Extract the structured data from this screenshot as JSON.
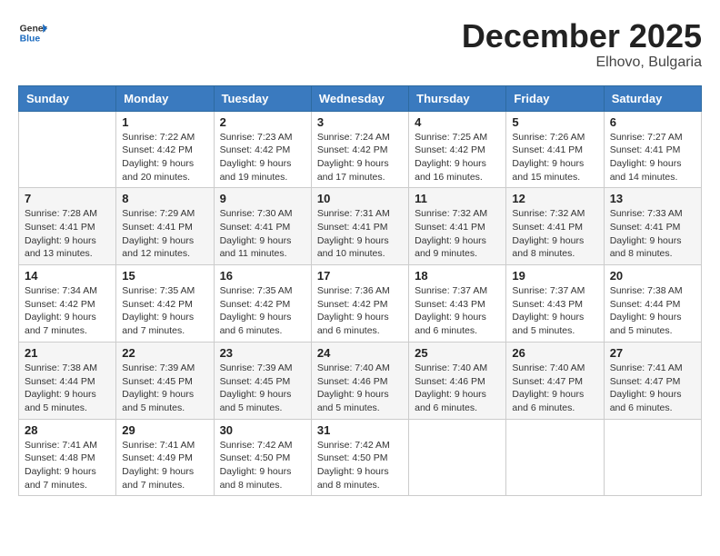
{
  "logo": {
    "general": "General",
    "blue": "Blue"
  },
  "title": "December 2025",
  "location": "Elhovo, Bulgaria",
  "weekdays": [
    "Sunday",
    "Monday",
    "Tuesday",
    "Wednesday",
    "Thursday",
    "Friday",
    "Saturday"
  ],
  "weeks": [
    [
      {
        "day": "",
        "info": ""
      },
      {
        "day": "1",
        "info": "Sunrise: 7:22 AM\nSunset: 4:42 PM\nDaylight: 9 hours\nand 20 minutes."
      },
      {
        "day": "2",
        "info": "Sunrise: 7:23 AM\nSunset: 4:42 PM\nDaylight: 9 hours\nand 19 minutes."
      },
      {
        "day": "3",
        "info": "Sunrise: 7:24 AM\nSunset: 4:42 PM\nDaylight: 9 hours\nand 17 minutes."
      },
      {
        "day": "4",
        "info": "Sunrise: 7:25 AM\nSunset: 4:42 PM\nDaylight: 9 hours\nand 16 minutes."
      },
      {
        "day": "5",
        "info": "Sunrise: 7:26 AM\nSunset: 4:41 PM\nDaylight: 9 hours\nand 15 minutes."
      },
      {
        "day": "6",
        "info": "Sunrise: 7:27 AM\nSunset: 4:41 PM\nDaylight: 9 hours\nand 14 minutes."
      }
    ],
    [
      {
        "day": "7",
        "info": "Sunrise: 7:28 AM\nSunset: 4:41 PM\nDaylight: 9 hours\nand 13 minutes."
      },
      {
        "day": "8",
        "info": "Sunrise: 7:29 AM\nSunset: 4:41 PM\nDaylight: 9 hours\nand 12 minutes."
      },
      {
        "day": "9",
        "info": "Sunrise: 7:30 AM\nSunset: 4:41 PM\nDaylight: 9 hours\nand 11 minutes."
      },
      {
        "day": "10",
        "info": "Sunrise: 7:31 AM\nSunset: 4:41 PM\nDaylight: 9 hours\nand 10 minutes."
      },
      {
        "day": "11",
        "info": "Sunrise: 7:32 AM\nSunset: 4:41 PM\nDaylight: 9 hours\nand 9 minutes."
      },
      {
        "day": "12",
        "info": "Sunrise: 7:32 AM\nSunset: 4:41 PM\nDaylight: 9 hours\nand 8 minutes."
      },
      {
        "day": "13",
        "info": "Sunrise: 7:33 AM\nSunset: 4:41 PM\nDaylight: 9 hours\nand 8 minutes."
      }
    ],
    [
      {
        "day": "14",
        "info": "Sunrise: 7:34 AM\nSunset: 4:42 PM\nDaylight: 9 hours\nand 7 minutes."
      },
      {
        "day": "15",
        "info": "Sunrise: 7:35 AM\nSunset: 4:42 PM\nDaylight: 9 hours\nand 7 minutes."
      },
      {
        "day": "16",
        "info": "Sunrise: 7:35 AM\nSunset: 4:42 PM\nDaylight: 9 hours\nand 6 minutes."
      },
      {
        "day": "17",
        "info": "Sunrise: 7:36 AM\nSunset: 4:42 PM\nDaylight: 9 hours\nand 6 minutes."
      },
      {
        "day": "18",
        "info": "Sunrise: 7:37 AM\nSunset: 4:43 PM\nDaylight: 9 hours\nand 6 minutes."
      },
      {
        "day": "19",
        "info": "Sunrise: 7:37 AM\nSunset: 4:43 PM\nDaylight: 9 hours\nand 5 minutes."
      },
      {
        "day": "20",
        "info": "Sunrise: 7:38 AM\nSunset: 4:44 PM\nDaylight: 9 hours\nand 5 minutes."
      }
    ],
    [
      {
        "day": "21",
        "info": "Sunrise: 7:38 AM\nSunset: 4:44 PM\nDaylight: 9 hours\nand 5 minutes."
      },
      {
        "day": "22",
        "info": "Sunrise: 7:39 AM\nSunset: 4:45 PM\nDaylight: 9 hours\nand 5 minutes."
      },
      {
        "day": "23",
        "info": "Sunrise: 7:39 AM\nSunset: 4:45 PM\nDaylight: 9 hours\nand 5 minutes."
      },
      {
        "day": "24",
        "info": "Sunrise: 7:40 AM\nSunset: 4:46 PM\nDaylight: 9 hours\nand 5 minutes."
      },
      {
        "day": "25",
        "info": "Sunrise: 7:40 AM\nSunset: 4:46 PM\nDaylight: 9 hours\nand 6 minutes."
      },
      {
        "day": "26",
        "info": "Sunrise: 7:40 AM\nSunset: 4:47 PM\nDaylight: 9 hours\nand 6 minutes."
      },
      {
        "day": "27",
        "info": "Sunrise: 7:41 AM\nSunset: 4:47 PM\nDaylight: 9 hours\nand 6 minutes."
      }
    ],
    [
      {
        "day": "28",
        "info": "Sunrise: 7:41 AM\nSunset: 4:48 PM\nDaylight: 9 hours\nand 7 minutes."
      },
      {
        "day": "29",
        "info": "Sunrise: 7:41 AM\nSunset: 4:49 PM\nDaylight: 9 hours\nand 7 minutes."
      },
      {
        "day": "30",
        "info": "Sunrise: 7:42 AM\nSunset: 4:50 PM\nDaylight: 9 hours\nand 8 minutes."
      },
      {
        "day": "31",
        "info": "Sunrise: 7:42 AM\nSunset: 4:50 PM\nDaylight: 9 hours\nand 8 minutes."
      },
      {
        "day": "",
        "info": ""
      },
      {
        "day": "",
        "info": ""
      },
      {
        "day": "",
        "info": ""
      }
    ]
  ]
}
